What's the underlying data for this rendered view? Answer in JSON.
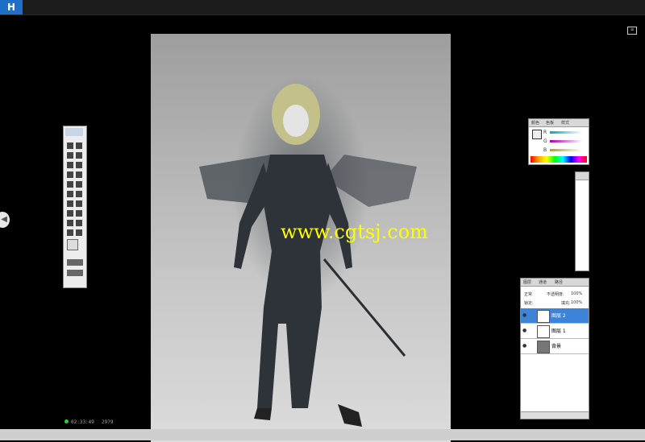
{
  "header": {
    "logo": "H",
    "channel": "",
    "info1": "",
    "info2": ""
  },
  "overlay": {
    "watermark": "www.cgtsj.com",
    "top_right_icon": "⌧",
    "left_handle": "◀"
  },
  "photoshop": {
    "color_panel": {
      "tabs": [
        "颜色",
        "色板",
        "样式"
      ],
      "labels": [
        "R",
        "G",
        "B"
      ],
      "values": [
        "",
        "",
        ""
      ]
    },
    "layers_panel": {
      "tabs": [
        "图层",
        "通道",
        "路径"
      ],
      "mode": "正常",
      "opacity_label": "不透明度:",
      "opacity_value": "100%",
      "lock_label": "锁定:",
      "fill_label": "填充:",
      "fill_value": "100%",
      "layers": [
        {
          "name": "图层 2",
          "selected": true
        },
        {
          "name": "图层 1",
          "selected": false
        },
        {
          "name": "背景",
          "selected": false
        }
      ]
    }
  },
  "status": {
    "time": "02:33:49",
    "count": "2979"
  },
  "colors": {
    "accent": "#1e6fc8",
    "watermark": "#ffff00",
    "layer_selected": "#3b84d9"
  }
}
